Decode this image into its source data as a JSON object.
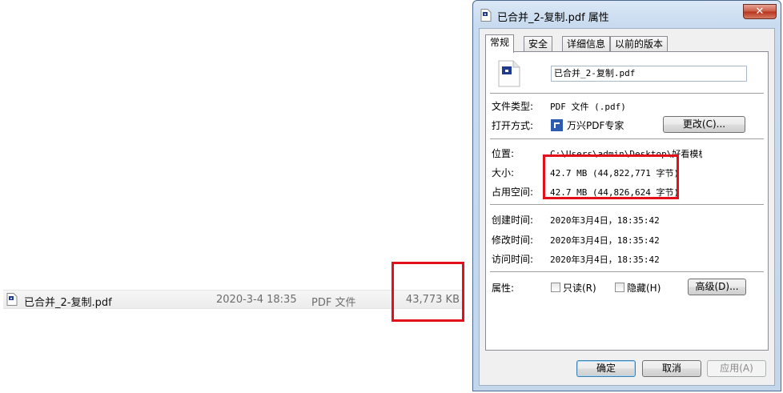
{
  "explorer": {
    "file": {
      "name": "已合并_2-复制.pdf",
      "date": "2020-3-4 18:35",
      "type": "PDF 文件",
      "size": "43,773 KB"
    }
  },
  "dialog": {
    "title": "已合并_2-复制.pdf 属性",
    "close_label": "✕",
    "tabs": [
      "常规",
      "安全",
      "详细信息",
      "以前的版本"
    ],
    "filename": "已合并_2-复制.pdf",
    "file_type_label": "文件类型:",
    "file_type_value": "PDF 文件 (.pdf)",
    "open_with_label": "打开方式:",
    "open_with_value": "万兴PDF专家",
    "change_button": "更改(C)...",
    "location_label": "位置:",
    "location_value": "C:\\Users\\admin\\Desktop\\好看模板",
    "size_label": "大小:",
    "size_value": "42.7 MB (44,822,771 字节)",
    "disk_size_label": "占用空间:",
    "disk_size_value": "42.7 MB (44,826,624 字节)",
    "created_label": "创建时间:",
    "created_value": "2020年3月4日，18:35:42",
    "modified_label": "修改时间:",
    "modified_value": "2020年3月4日，18:35:42",
    "accessed_label": "访问时间:",
    "accessed_value": "2020年3月4日，18:35:42",
    "attributes_label": "属性:",
    "readonly_label": "只读(R)",
    "hidden_label": "隐藏(H)",
    "advanced_button": "高级(D)...",
    "ok_button": "确定",
    "cancel_button": "取消",
    "apply_button": "应用(A)"
  },
  "colors": {
    "highlight_box": "#e3101c",
    "pdf_icon_blue": "#1f3b8f",
    "wondershare_blue": "#2d5bb0"
  }
}
